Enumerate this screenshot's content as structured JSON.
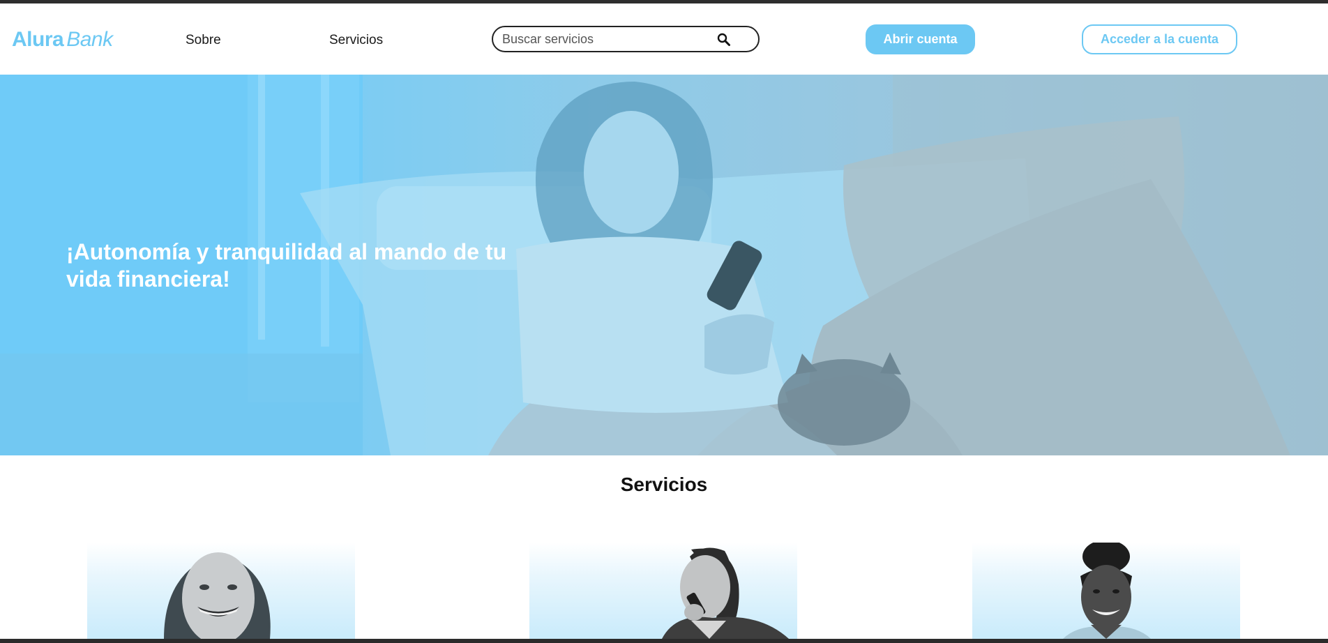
{
  "header": {
    "logo": {
      "part1": "Alura",
      "part2": "Bank"
    },
    "nav": [
      {
        "label": "Sobre"
      },
      {
        "label": "Servicios"
      }
    ],
    "search": {
      "placeholder": "Buscar servicios",
      "value": "",
      "icon": "search-icon"
    },
    "open_account_label": "Abrir cuenta",
    "access_account_label": "Acceder a la cuenta"
  },
  "hero": {
    "title": "¡Autonomía y tranquilidad al mando de tu vida financiera!"
  },
  "services": {
    "title": "Servicios",
    "cards": [
      {
        "image": "smiling-woman-portrait"
      },
      {
        "image": "man-with-phone-portrait"
      },
      {
        "image": "woman-with-bun-portrait"
      }
    ]
  },
  "colors": {
    "accent": "#6cc8f3",
    "header_bg": "#ffffff",
    "text": "#111111",
    "button_text": "#ffffff"
  }
}
